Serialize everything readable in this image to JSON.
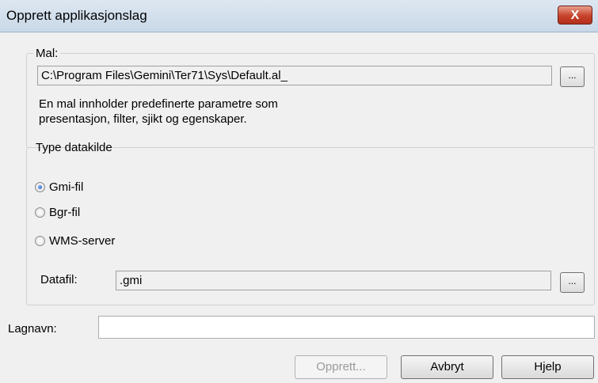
{
  "window": {
    "title": "Opprett applikasjonslag",
    "close_label": "X"
  },
  "template_group": {
    "legend": "Mal:",
    "path_value": "C:\\Program Files\\Gemini\\Ter71\\Sys\\Default.al_",
    "browse_label": "...",
    "description_line1": "En mal innholder predefinerte parametre som",
    "description_line2": "presentasjon, filter, sjikt og egenskaper."
  },
  "datasource_group": {
    "legend": "Type datakilde",
    "options": [
      {
        "label": "Gmi-fil",
        "selected": true
      },
      {
        "label": "Bgr-fil",
        "selected": false
      },
      {
        "label": "WMS-server",
        "selected": false
      }
    ],
    "datafile_label": "Datafil:",
    "datafile_value": ".gmi",
    "browse_label": "..."
  },
  "layer_name": {
    "label": "Lagnavn:",
    "value": ""
  },
  "buttons": {
    "create": "Opprett...",
    "cancel": "Avbryt",
    "help": "Hjelp"
  }
}
